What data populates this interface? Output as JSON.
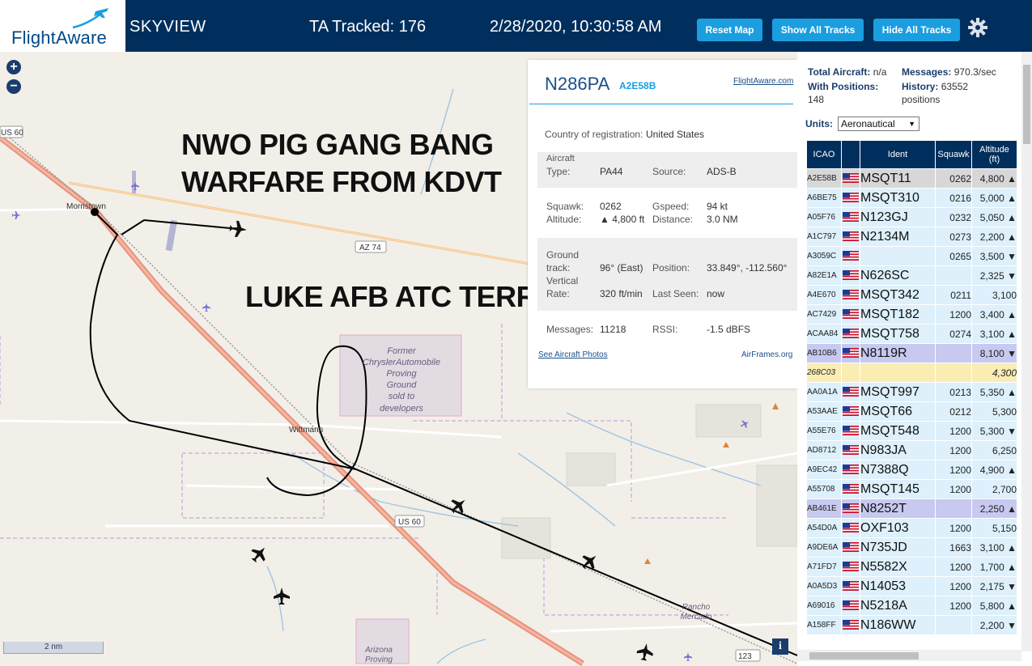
{
  "header": {
    "logo": "FlightAware",
    "app_title": "SKYVIEW",
    "ta_tracked": "TA Tracked: 176",
    "datetime": "2/28/2020, 10:30:58 AM",
    "reset_map": "Reset Map",
    "show_all_tracks": "Show All Tracks",
    "hide_all_tracks": "Hide All Tracks",
    "settings_icon": "gear-icon"
  },
  "map": {
    "zoom_in": "+",
    "zoom_out": "−",
    "overlay_line1": "NWO PIG GANG BANG",
    "overlay_line2": "WARFARE FROM KDVT",
    "overlay_line3": "LUKE AFB ATC TERRORISM",
    "label_us60_a": "US 60",
    "label_us60_b": "US 60",
    "label_az74": "AZ 74",
    "label_morristown": "Morristown",
    "label_wittmann": "Wittmann",
    "label_former": "Former",
    "label_chrysler": "ChryslerAutomobile",
    "label_proving": "Proving",
    "label_ground": "Ground",
    "label_sold": "sold to",
    "label_developers": "developers",
    "label_rancho": "Rancho",
    "label_mercado": "Mercado",
    "label_arizona": "Arizona",
    "label_proving2": "Proving",
    "label_123": "123",
    "scale": "2 nm",
    "info": "i"
  },
  "popup": {
    "registration": "N286PA",
    "hex": "A2E58B",
    "fa_link": "FlightAware.com",
    "country_label": "Country of registration:",
    "country_value": "United States",
    "aircraft_type_label1": "Aircraft",
    "aircraft_type_label2": "Type:",
    "aircraft_type": "PA44",
    "source_label": "Source:",
    "source": "ADS-B",
    "squawk_label": "Squawk:",
    "squawk": "0262",
    "gspeed_label": "Gspeed:",
    "gspeed": "94 kt",
    "altitude_label": "Altitude:",
    "altitude": "▲ 4,800 ft",
    "distance_label": "Distance:",
    "distance": "3.0 NM",
    "ground_label1": "Ground",
    "ground_label2": "track:",
    "ground_track": "96° (East)",
    "position_label": "Position:",
    "position": "33.849°, -112.560°",
    "vertical_label1": "Vertical",
    "vertical_label2": "Rate:",
    "vertical_rate": "320 ft/min",
    "last_seen_label": "Last Seen:",
    "last_seen": "now",
    "messages_label": "Messages:",
    "messages": "11218",
    "rssi_label": "RSSI:",
    "rssi": "-1.5 dBFS",
    "photos_link": "See Aircraft Photos",
    "airframes_link": "AirFrames.org"
  },
  "sidebar": {
    "total_aircraft_label": "Total Aircraft:",
    "total_aircraft": "n/a",
    "messages_label": "Messages:",
    "messages": "970.3/sec",
    "with_positions_label": "With Positions:",
    "with_positions": "148",
    "history_label": "History:",
    "history": "63552",
    "history_unit": "positions",
    "units_label": "Units:",
    "units_value": "Aeronautical",
    "columns": {
      "icao": "ICAO",
      "flag": "",
      "ident": "Ident",
      "squawk": "Squawk",
      "alt1": "Altitude",
      "alt2": "(ft)"
    },
    "rows": [
      {
        "icao": "A2E58B",
        "ident": "MSQT11",
        "squawk": "0262",
        "alt": "4,800 ▲",
        "flag": true,
        "cls": "sel"
      },
      {
        "icao": "A6BE75",
        "ident": "MSQT310",
        "squawk": "0216",
        "alt": "5,000 ▲",
        "flag": true,
        "cls": ""
      },
      {
        "icao": "A05F76",
        "ident": "N123GJ",
        "squawk": "0232",
        "alt": "5,050 ▲",
        "flag": true,
        "cls": ""
      },
      {
        "icao": "A1C797",
        "ident": "N2134M",
        "squawk": "0273",
        "alt": "2,200 ▲",
        "flag": true,
        "cls": ""
      },
      {
        "icao": "A3059C",
        "ident": "",
        "squawk": "0265",
        "alt": "3,500 ▼",
        "flag": true,
        "cls": ""
      },
      {
        "icao": "A82E1A",
        "ident": "N626SC",
        "squawk": "",
        "alt": "2,325 ▼",
        "flag": true,
        "cls": ""
      },
      {
        "icao": "A4E670",
        "ident": "MSQT342",
        "squawk": "0211",
        "alt": "3,100",
        "flag": true,
        "cls": ""
      },
      {
        "icao": "AC7429",
        "ident": "MSQT182",
        "squawk": "1200",
        "alt": "3,400 ▲",
        "flag": true,
        "cls": ""
      },
      {
        "icao": "ACAA84",
        "ident": "MSQT758",
        "squawk": "0274",
        "alt": "3,100 ▲",
        "flag": true,
        "cls": ""
      },
      {
        "icao": "AB10B6",
        "ident": "N8119R",
        "squawk": "",
        "alt": "8,100 ▼",
        "flag": true,
        "cls": "hl"
      },
      {
        "icao": "268C03",
        "ident": "",
        "squawk": "",
        "alt": "4,300",
        "flag": false,
        "cls": "pend"
      },
      {
        "icao": "AA0A1A",
        "ident": "MSQT997",
        "squawk": "0213",
        "alt": "5,350 ▲",
        "flag": true,
        "cls": ""
      },
      {
        "icao": "A53AAE",
        "ident": "MSQT66",
        "squawk": "0212",
        "alt": "5,300",
        "flag": true,
        "cls": ""
      },
      {
        "icao": "A55E76",
        "ident": "MSQT548",
        "squawk": "1200",
        "alt": "5,300 ▼",
        "flag": true,
        "cls": ""
      },
      {
        "icao": "AD8712",
        "ident": "N983JA",
        "squawk": "1200",
        "alt": "6,250",
        "flag": true,
        "cls": ""
      },
      {
        "icao": "A9EC42",
        "ident": "N7388Q",
        "squawk": "1200",
        "alt": "4,900 ▲",
        "flag": true,
        "cls": ""
      },
      {
        "icao": "A55708",
        "ident": "MSQT145",
        "squawk": "1200",
        "alt": "2,700",
        "flag": true,
        "cls": ""
      },
      {
        "icao": "AB461E",
        "ident": "N8252T",
        "squawk": "",
        "alt": "2,250 ▲",
        "flag": true,
        "cls": "hl"
      },
      {
        "icao": "A54D0A",
        "ident": "OXF103",
        "squawk": "1200",
        "alt": "5,150",
        "flag": true,
        "cls": ""
      },
      {
        "icao": "A9DE6A",
        "ident": "N735JD",
        "squawk": "1663",
        "alt": "3,100 ▲",
        "flag": true,
        "cls": ""
      },
      {
        "icao": "A71FD7",
        "ident": "N5582X",
        "squawk": "1200",
        "alt": "1,700 ▲",
        "flag": true,
        "cls": ""
      },
      {
        "icao": "A0A5D3",
        "ident": "N14053",
        "squawk": "1200",
        "alt": "2,175 ▼",
        "flag": true,
        "cls": ""
      },
      {
        "icao": "A69016",
        "ident": "N5218A",
        "squawk": "1200",
        "alt": "5,800 ▲",
        "flag": true,
        "cls": ""
      },
      {
        "icao": "A158FF",
        "ident": "N186WW",
        "squawk": "",
        "alt": "2,200 ▼",
        "flag": true,
        "cls": ""
      }
    ]
  },
  "colors": {
    "header_bg": "#002f5d",
    "button_bg": "#1a9ee0",
    "table_row": "#ddf0fb",
    "selected_row": "#d7d7d7",
    "highlight_row": "#c7c9f0",
    "pending_row": "#faedb4",
    "track_line": "#000000",
    "highway": "#e8927c"
  }
}
